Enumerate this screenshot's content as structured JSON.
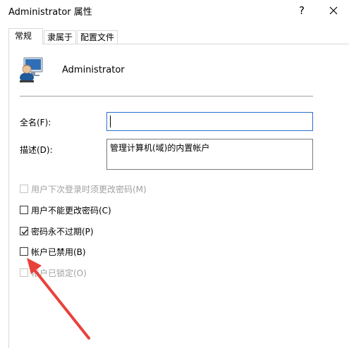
{
  "window": {
    "title": "Administrator 属性",
    "help_label": "?",
    "help_icon": "help-icon",
    "close_icon": "close-icon"
  },
  "tabs": [
    {
      "label": "常规",
      "active": true
    },
    {
      "label": "隶属于",
      "active": false
    },
    {
      "label": "配置文件",
      "active": false
    }
  ],
  "general": {
    "user_icon": "user-computer-icon",
    "user_name": "Administrator",
    "fullname_label": "全名(F):",
    "fullname_value": "",
    "description_label": "描述(D):",
    "description_value": "管理计算机(域)的内置帐户",
    "checkboxes": [
      {
        "label": "用户下次登录时须更改密码(M)",
        "checked": false,
        "enabled": false
      },
      {
        "label": "用户不能更改密码(C)",
        "checked": false,
        "enabled": true
      },
      {
        "label": "密码永不过期(P)",
        "checked": true,
        "enabled": true
      },
      {
        "label": "帐户已禁用(B)",
        "checked": false,
        "enabled": true
      },
      {
        "label": "帐户已锁定(O)",
        "checked": false,
        "enabled": false
      }
    ]
  },
  "annotation": {
    "arrow_color": "#e8413a"
  }
}
